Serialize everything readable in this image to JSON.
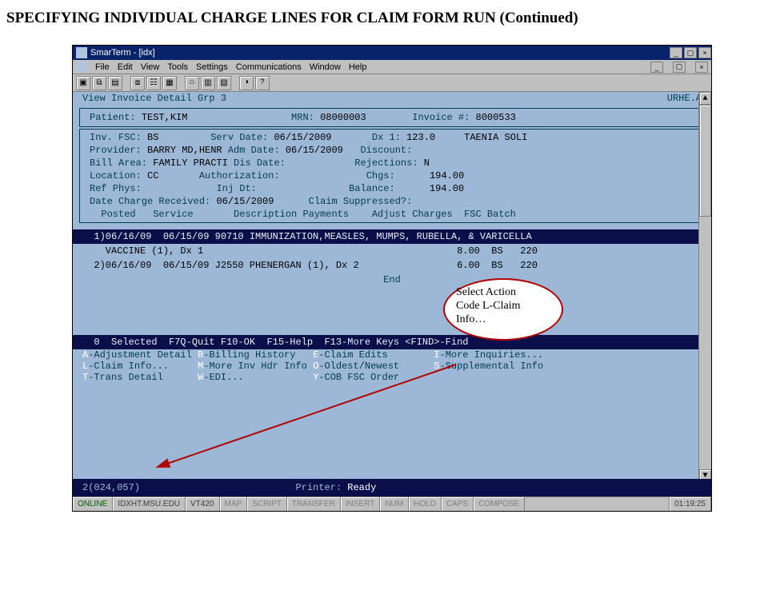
{
  "page": {
    "title": "SPECIFYING INDIVIDUAL CHARGE LINES FOR CLAIM FORM RUN (Continued)"
  },
  "window": {
    "app_title": "SmarTerm - [idx]",
    "menus": [
      "File",
      "Edit",
      "View",
      "Tools",
      "Settings",
      "Communications",
      "Window",
      "Help"
    ]
  },
  "terminal": {
    "header_left": "View Invoice Detail Grp 3",
    "header_right": "URHE.A",
    "patient_block": {
      "patient_label": "Patient:",
      "patient": "TEST,KIM",
      "mrn_label": "MRN:",
      "mrn": "08000003",
      "invoice_label": "Invoice #:",
      "invoice": "8000533"
    },
    "detail_block": {
      "inv_fsc_label": "Inv. FSC:",
      "inv_fsc": "BS",
      "serv_date_label": "Serv Date:",
      "serv_date": "06/15/2009",
      "dx1_label": "Dx 1:",
      "dx1": "123.0",
      "dx1_desc": "TAENIA SOLI",
      "provider_label": "Provider:",
      "provider": "BARRY MD,HENR",
      "adm_date_label": "Adm Date:",
      "adm_date": "06/15/2009",
      "discount_label": "Discount:",
      "bill_area_label": "Bill Area:",
      "bill_area": "FAMILY PRACTI",
      "dis_date_label": "Dis Date:",
      "rejections_label": "Rejections:",
      "rejections": "N",
      "location_label": "Location:",
      "location": "CC",
      "authorization_label": "Authorization:",
      "chgs_label": "Chgs:",
      "chgs": "194.00",
      "ref_phys_label": "Ref Phys:",
      "inj_dt_label": "Inj Dt:",
      "balance_label": "Balance:",
      "balance": "194.00",
      "date_charge_label": "Date Charge Received:",
      "date_charge": "06/15/2009",
      "claim_suppressed_label": "Claim Suppressed?:"
    },
    "columns_row": "  Posted   Service       Description Payments    Adjust Charges  FSC Batch",
    "lines": [
      {
        "row1": "  1)06/16/09  06/15/09 90710 IMMUNIZATION,MEASLES, MUMPS, RUBELLA, & VARICELLA",
        "row2": "    VACCINE (1), Dx 1                                            8.00  BS   220"
      },
      {
        "row1": "  2)06/16/09  06/15/09 J2550 PHENERGAN (1), Dx 2                 6.00  BS   220"
      }
    ],
    "end_label": "End",
    "fk_header": "  0  Selected  F7Q-Quit F10-OK  F15-Help  F13-More Keys <FIND>-Find",
    "actions": {
      "a": {
        "key": "A",
        "label": "-Adjustment Detail"
      },
      "b": {
        "key": "B",
        "label": "-Billing History"
      },
      "e": {
        "key": "E",
        "label": "-Claim Edits"
      },
      "i": {
        "key": "I",
        "label": "-More Inquiries..."
      },
      "l": {
        "key": "L",
        "label": "-Claim Info..."
      },
      "m": {
        "key": "M",
        "label": "-More Inv Hdr Info"
      },
      "o": {
        "key": "O",
        "label": "-Oldest/Newest"
      },
      "s": {
        "key": "S",
        "label": "-Supplemental Info"
      },
      "t": {
        "key": "T",
        "label": "-Trans Detail"
      },
      "w": {
        "key": "W",
        "label": "-EDI..."
      },
      "y": {
        "key": "Y",
        "label": "-COB FSC Order"
      }
    },
    "status_row": {
      "cursor": "2(024,057)",
      "printer": "Printer: ",
      "ready": "Ready"
    }
  },
  "statusbar": {
    "cells": [
      "ONLINE",
      "IDXHT.MSU.EDU",
      "VT420",
      "MAP",
      "SCRIPT",
      "TRANSFER",
      "INSERT",
      "NUM",
      "HOLD",
      "CAPS",
      "COMPOSE",
      "01:19:25"
    ]
  },
  "callout": {
    "l1": "Select Action",
    "l2": "Code L-Claim",
    "l3": "Info…"
  }
}
